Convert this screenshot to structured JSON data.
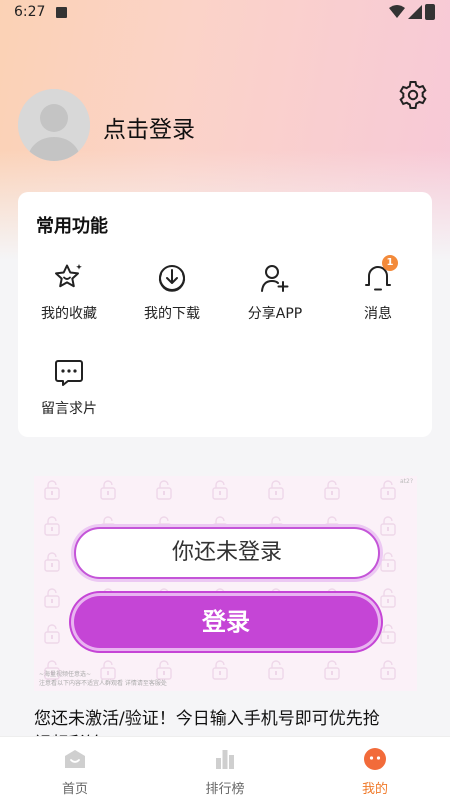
{
  "status_bar": {
    "time": "6:27"
  },
  "profile": {
    "login_text": "点击登录"
  },
  "functions_card": {
    "title": "常用功能",
    "items": [
      {
        "label": "我的收藏",
        "icon": "star-icon"
      },
      {
        "label": "我的下载",
        "icon": "download-icon"
      },
      {
        "label": "分享APP",
        "icon": "add-user-icon"
      },
      {
        "label": "消息",
        "icon": "bell-icon",
        "badge": "1"
      },
      {
        "label": "留言求片",
        "icon": "chat-bubble-icon"
      }
    ]
  },
  "ad": {
    "field_text": "你还未登录",
    "button_label": "登录",
    "top_right_mark": "at2?",
    "footnote_1": "~海量视频任意选~",
    "footnote_2": "注意看以下内容不适宜人群观看 详情请至客服处"
  },
  "notice": {
    "line1": "您还未激活/验证！今日输入手机号即可优先抢",
    "line2": "视频彩铃"
  },
  "bottom_nav": {
    "items": [
      {
        "label": "首页",
        "icon": "home-icon"
      },
      {
        "label": "排行榜",
        "icon": "ranking-icon"
      },
      {
        "label": "我的",
        "icon": "profile-face-icon",
        "active": true
      }
    ]
  },
  "colors": {
    "accent": "#f07a2a",
    "ad_purple": "#c545d6",
    "badge": "#f38a3a"
  }
}
